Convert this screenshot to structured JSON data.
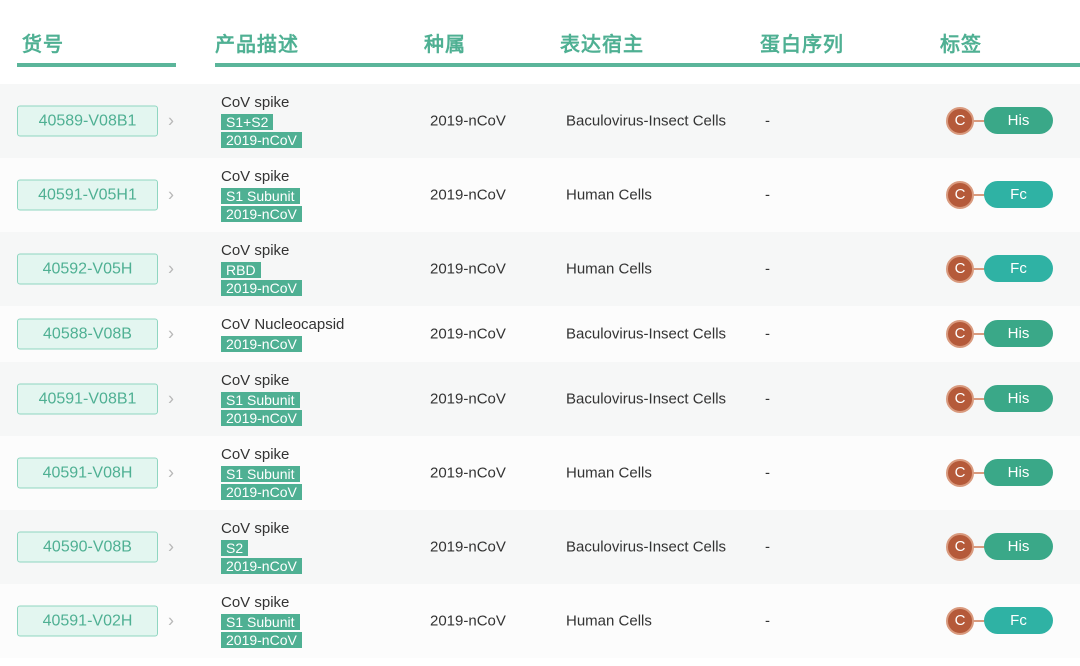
{
  "headers": {
    "sku": "货号",
    "description": "产品描述",
    "species": "种属",
    "host": "表达宿主",
    "sequence": "蛋白序列",
    "label": "标签"
  },
  "colors": {
    "accent": "#4fb093",
    "tag_c": "#b55a3a",
    "his": "#3aa888",
    "fc": "#2fb2a4"
  },
  "rows": [
    {
      "sku": "40589-V08B1",
      "desc": "CoV spike",
      "tags": [
        "S1+S2",
        "2019-nCoV"
      ],
      "species": "2019-nCoV",
      "host": "Baculovirus-Insect Cells",
      "sequence": "-",
      "label_c": "C",
      "label": "His"
    },
    {
      "sku": "40591-V05H1",
      "desc": "CoV spike",
      "tags": [
        "S1 Subunit",
        "2019-nCoV"
      ],
      "species": "2019-nCoV",
      "host": "Human Cells",
      "sequence": "-",
      "label_c": "C",
      "label": "Fc"
    },
    {
      "sku": "40592-V05H",
      "desc": "CoV spike",
      "tags": [
        "RBD",
        "2019-nCoV"
      ],
      "species": "2019-nCoV",
      "host": "Human Cells",
      "sequence": "-",
      "label_c": "C",
      "label": "Fc"
    },
    {
      "sku": "40588-V08B",
      "desc": "CoV Nucleocapsid",
      "tags": [
        "2019-nCoV"
      ],
      "species": "2019-nCoV",
      "host": "Baculovirus-Insect Cells",
      "sequence": "-",
      "label_c": "C",
      "label": "His"
    },
    {
      "sku": "40591-V08B1",
      "desc": "CoV spike",
      "tags": [
        "S1 Subunit",
        "2019-nCoV"
      ],
      "species": "2019-nCoV",
      "host": "Baculovirus-Insect Cells",
      "sequence": "-",
      "label_c": "C",
      "label": "His"
    },
    {
      "sku": "40591-V08H",
      "desc": "CoV spike",
      "tags": [
        "S1 Subunit",
        "2019-nCoV"
      ],
      "species": "2019-nCoV",
      "host": "Human Cells",
      "sequence": "-",
      "label_c": "C",
      "label": "His"
    },
    {
      "sku": "40590-V08B",
      "desc": "CoV spike",
      "tags": [
        "S2",
        "2019-nCoV"
      ],
      "species": "2019-nCoV",
      "host": "Baculovirus-Insect Cells",
      "sequence": "-",
      "label_c": "C",
      "label": "His"
    },
    {
      "sku": "40591-V02H",
      "desc": "CoV spike",
      "tags": [
        "S1 Subunit",
        "2019-nCoV"
      ],
      "species": "2019-nCoV",
      "host": "Human Cells",
      "sequence": "-",
      "label_c": "C",
      "label": "Fc"
    }
  ]
}
